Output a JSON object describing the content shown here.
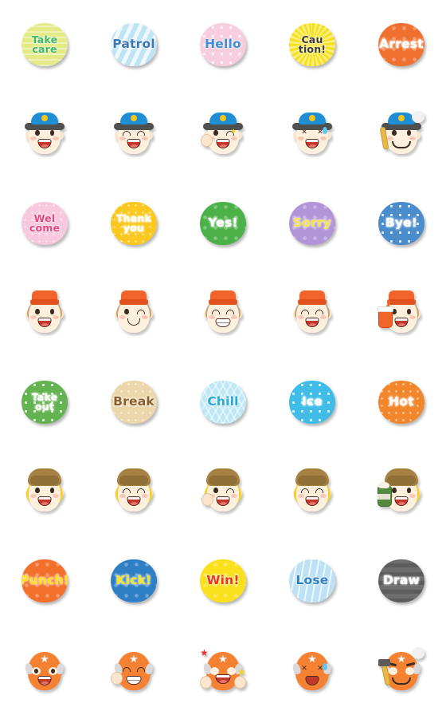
{
  "sheet": {
    "title": "Emoji sticker sheet",
    "background_color": "#ffffff",
    "columns": 5,
    "rows": 8,
    "cell_size": 112
  },
  "rows": [
    {
      "index": 1,
      "kind": "speech-bubble",
      "items": [
        {
          "text": "Take\ncare",
          "lines": 2,
          "bg": "#e4ea86",
          "fg": "#3fb866",
          "pattern": "horizontal-stripes"
        },
        {
          "text": "Patrol",
          "lines": 1,
          "bg": "#bfe5f5",
          "fg": "#3f76b5",
          "pattern": "diagonal-stripes"
        },
        {
          "text": "Hello",
          "lines": 1,
          "bg": "#f7cede",
          "fg": "#3f8fd4",
          "pattern": "polka-dots"
        },
        {
          "text": "Cau\ntion!",
          "lines": 2,
          "bg": "#f6e019",
          "fg": "#3b3b3b",
          "pattern": "rays"
        },
        {
          "text": "Arrest",
          "lines": 1,
          "bg": "#f0712f",
          "fg": "#ffffff",
          "pattern": "stars"
        }
      ]
    },
    {
      "index": 2,
      "kind": "face",
      "character": "police-officer",
      "items": [
        {
          "name": "police-smile",
          "expression": "smiling",
          "props": []
        },
        {
          "name": "police-laugh",
          "expression": "laughing-closed-eyes",
          "props": []
        },
        {
          "name": "police-salute",
          "expression": "winking-star",
          "props": [
            "saluting-hand",
            "star"
          ]
        },
        {
          "name": "police-distress",
          "expression": "distressed-crying",
          "props": [
            "sweat-drop"
          ]
        },
        {
          "name": "police-stern",
          "expression": "stern-mustache",
          "props": [
            "baton",
            "puff"
          ]
        }
      ]
    },
    {
      "index": 3,
      "kind": "speech-bubble",
      "items": [
        {
          "text": "Wel\ncome",
          "lines": 2,
          "bg": "#f8c9de",
          "fg": "#e8457f",
          "pattern": "sparkles"
        },
        {
          "text": "Thank\nyou",
          "lines": 2,
          "bg": "#fac81e",
          "fg": "#ffffff",
          "pattern": "sparkles"
        },
        {
          "text": "Yes!",
          "lines": 1,
          "bg": "#4bb148",
          "fg": "#ffffff",
          "pattern": "stars"
        },
        {
          "text": "Sorry",
          "lines": 1,
          "bg": "#b295d8",
          "fg": "#f5e53f",
          "pattern": "stars"
        },
        {
          "text": "Bye!",
          "lines": 1,
          "bg": "#4b8ccd",
          "fg": "#ffffff",
          "pattern": "polka-dots"
        }
      ]
    },
    {
      "index": 4,
      "kind": "face",
      "character": "fast-food-crew",
      "items": [
        {
          "name": "crew-smile",
          "expression": "smiling",
          "props": []
        },
        {
          "name": "crew-wink",
          "expression": "winking-smile",
          "props": []
        },
        {
          "name": "crew-grin",
          "expression": "grinning-closed-eyes",
          "props": []
        },
        {
          "name": "crew-laugh",
          "expression": "laughing-closed-eyes",
          "props": []
        },
        {
          "name": "crew-soda",
          "expression": "smiling",
          "props": [
            "soda-cup"
          ]
        }
      ]
    },
    {
      "index": 5,
      "kind": "speech-bubble",
      "items": [
        {
          "text": "Take\nout",
          "lines": 2,
          "bg": "#63b451",
          "fg": "#ffffff",
          "pattern": "polka-dots"
        },
        {
          "text": "Break",
          "lines": 1,
          "bg": "#ecd7ac",
          "fg": "#8b5e2b",
          "pattern": "sparkles"
        },
        {
          "text": "Chill",
          "lines": 1,
          "bg": "#bfe8f6",
          "fg": "#2aa9d8",
          "pattern": "cross-hatch"
        },
        {
          "text": "Ice",
          "lines": 1,
          "bg": "#3fbde8",
          "fg": "#ffffff",
          "pattern": "polka-dots"
        },
        {
          "text": "Hot",
          "lines": 1,
          "bg": "#f2862a",
          "fg": "#ffffff",
          "pattern": "sparkles"
        }
      ]
    },
    {
      "index": 6,
      "kind": "face",
      "character": "barista",
      "items": [
        {
          "name": "barista-smile",
          "expression": "smiling",
          "props": []
        },
        {
          "name": "barista-laugh",
          "expression": "laughing-closed-eyes",
          "props": []
        },
        {
          "name": "barista-wink",
          "expression": "winking-wave",
          "props": [
            "waving-hand"
          ]
        },
        {
          "name": "barista-happy",
          "expression": "laughing-closed-eyes",
          "props": []
        },
        {
          "name": "barista-coffee",
          "expression": "smiling",
          "props": [
            "coffee-cup"
          ]
        }
      ]
    },
    {
      "index": 7,
      "kind": "speech-bubble",
      "items": [
        {
          "text": "Punch!",
          "lines": 1,
          "bg": "#f2702c",
          "fg": "#fbe31c",
          "pattern": "stars"
        },
        {
          "text": "Kick!",
          "lines": 1,
          "bg": "#2f7fc4",
          "fg": "#fbe31c",
          "pattern": "stars"
        },
        {
          "text": "Win!",
          "lines": 1,
          "bg": "#fbe01d",
          "fg": "#e8342b",
          "pattern": "stars"
        },
        {
          "text": "Lose",
          "lines": 1,
          "bg": "#bde2f5",
          "fg": "#2f7fc4",
          "pattern": "rain"
        },
        {
          "text": "Draw",
          "lines": 1,
          "bg": "#6e6e6e",
          "fg": "#ffffff",
          "pattern": "gray-stripes"
        }
      ]
    },
    {
      "index": 8,
      "kind": "face",
      "character": "luchador",
      "items": [
        {
          "name": "lucha-smile",
          "expression": "smiling",
          "props": []
        },
        {
          "name": "lucha-peace",
          "expression": "grinning-closed-eyes",
          "props": [
            "peace-hand"
          ]
        },
        {
          "name": "lucha-cheer",
          "expression": "excited",
          "props": [
            "fists",
            "red-star",
            "yellow-star"
          ]
        },
        {
          "name": "lucha-ko",
          "expression": "knocked-out",
          "props": [
            "sweat-drop"
          ]
        },
        {
          "name": "lucha-angry",
          "expression": "angry-mustache",
          "props": [
            "hammer",
            "puff"
          ]
        }
      ]
    }
  ]
}
